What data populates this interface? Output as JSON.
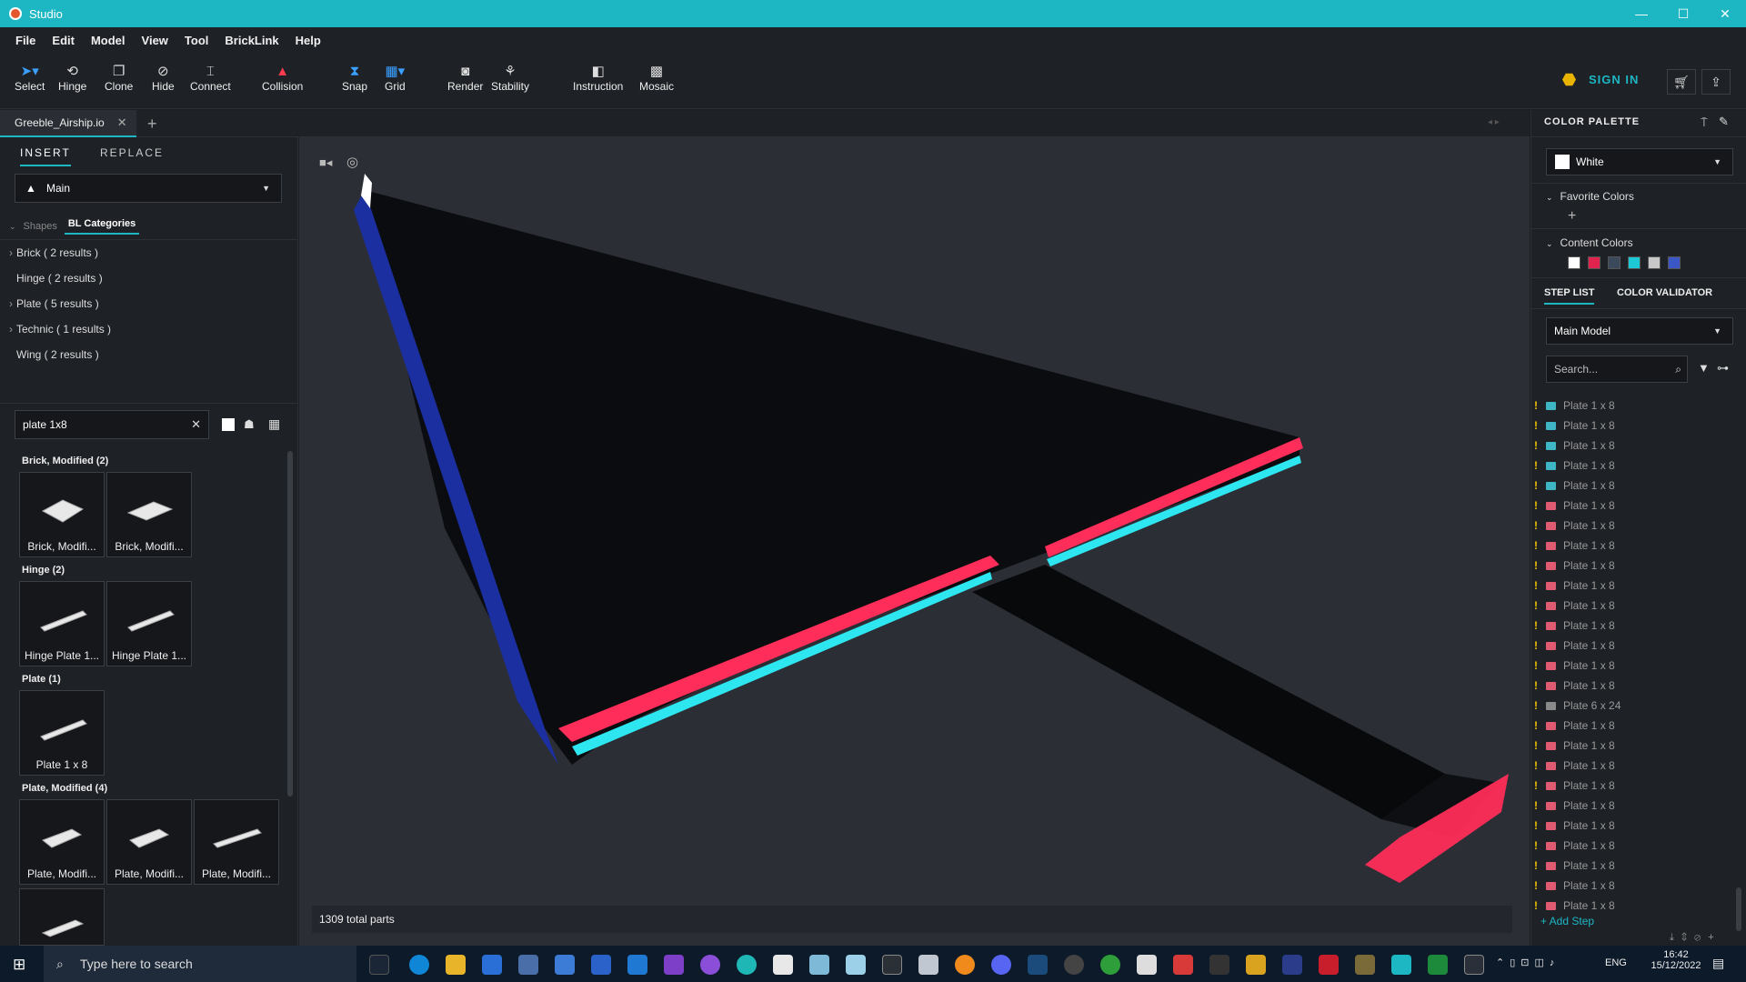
{
  "window": {
    "title": "Studio",
    "minimize": "—",
    "maximize": "☐",
    "close": "✕"
  },
  "menu": [
    "File",
    "Edit",
    "Model",
    "View",
    "Tool",
    "BrickLink",
    "Help"
  ],
  "toolbar": {
    "tools": [
      {
        "label": "Select",
        "icon": "cursor-icon"
      },
      {
        "label": "Hinge",
        "icon": "hinge-icon"
      },
      {
        "label": "Clone",
        "icon": "clone-icon"
      },
      {
        "label": "Hide",
        "icon": "eye-off-icon"
      },
      {
        "label": "Connect",
        "icon": "connect-icon"
      },
      {
        "label": "Collision",
        "icon": "collision-icon"
      },
      {
        "label": "Snap",
        "icon": "snap-icon"
      },
      {
        "label": "Grid",
        "icon": "grid-icon"
      },
      {
        "label": "Render",
        "icon": "camera-icon"
      },
      {
        "label": "Stability",
        "icon": "stability-icon"
      },
      {
        "label": "Instruction",
        "icon": "instruction-icon"
      },
      {
        "label": "Mosaic",
        "icon": "mosaic-icon"
      }
    ],
    "sign_in": "SIGN IN"
  },
  "document_tab": {
    "name": "Greeble_Airship.io"
  },
  "left_panel": {
    "tabs": [
      "INSERT",
      "REPLACE"
    ],
    "palette_select": "Main",
    "subtabs": [
      "Shapes",
      "BL Categories"
    ],
    "categories": [
      "Brick ( 2 results )",
      "Hinge ( 2 results )",
      "Plate ( 5 results )",
      "Technic ( 1 results )",
      "Wing ( 2 results )"
    ],
    "search_value": "plate 1x8",
    "groups": [
      {
        "title": "Brick, Modified (2)",
        "items": [
          "Brick, Modifi...",
          "Brick, Modifi..."
        ]
      },
      {
        "title": "Hinge (2)",
        "items": [
          "Hinge Plate 1...",
          "Hinge Plate 1..."
        ]
      },
      {
        "title": "Plate (1)",
        "items": [
          "Plate 1 x 8"
        ]
      },
      {
        "title": "Plate, Modified (4)",
        "items": [
          "Plate, Modifi...",
          "Plate, Modifi...",
          "Plate, Modifi..."
        ]
      }
    ]
  },
  "viewport": {
    "status": "1309 total parts"
  },
  "right_panel": {
    "color_palette_title": "COLOR PALETTE",
    "selected_color": "White",
    "favorite_colors": "Favorite Colors",
    "content_colors": "Content Colors",
    "content_swatches": [
      "#ffffff",
      "#e0244f",
      "#3a4a5c",
      "#1dc9d4",
      "#c8c8c8",
      "#3b57c6"
    ],
    "step_tabs": [
      "STEP LIST",
      "COLOR VALIDATOR"
    ],
    "model_select": "Main Model",
    "search_placeholder": "Search...",
    "steps": [
      {
        "label": "Plate 1 x 8",
        "color": "#3fb6c5"
      },
      {
        "label": "Plate 1 x 8",
        "color": "#3fb6c5"
      },
      {
        "label": "Plate 1 x 8",
        "color": "#3fb6c5"
      },
      {
        "label": "Plate 1 x 8",
        "color": "#3fb6c5"
      },
      {
        "label": "Plate 1 x 8",
        "color": "#3fb6c5"
      },
      {
        "label": "Plate 1 x 8",
        "color": "#e05a72"
      },
      {
        "label": "Plate 1 x 8",
        "color": "#e05a72"
      },
      {
        "label": "Plate 1 x 8",
        "color": "#e05a72"
      },
      {
        "label": "Plate 1 x 8",
        "color": "#e05a72"
      },
      {
        "label": "Plate 1 x 8",
        "color": "#e05a72"
      },
      {
        "label": "Plate 1 x 8",
        "color": "#e05a72"
      },
      {
        "label": "Plate 1 x 8",
        "color": "#e05a72"
      },
      {
        "label": "Plate 1 x 8",
        "color": "#e05a72"
      },
      {
        "label": "Plate 1 x 8",
        "color": "#e05a72"
      },
      {
        "label": "Plate 1 x 8",
        "color": "#e05a72"
      },
      {
        "label": "Plate 6 x 24",
        "color": "#8a8a8a"
      },
      {
        "label": "Plate 1 x 8",
        "color": "#e05a72"
      },
      {
        "label": "Plate 1 x 8",
        "color": "#e05a72"
      },
      {
        "label": "Plate 1 x 8",
        "color": "#e05a72"
      },
      {
        "label": "Plate 1 x 8",
        "color": "#e05a72"
      },
      {
        "label": "Plate 1 x 8",
        "color": "#e05a72"
      },
      {
        "label": "Plate 1 x 8",
        "color": "#e05a72"
      },
      {
        "label": "Plate 1 x 8",
        "color": "#e05a72"
      },
      {
        "label": "Plate 1 x 8",
        "color": "#e05a72"
      },
      {
        "label": "Plate 1 x 8",
        "color": "#e05a72"
      },
      {
        "label": "Plate 1 x 8",
        "color": "#e05a72"
      }
    ],
    "add_step": "+ Add Step"
  },
  "taskbar": {
    "search_placeholder": "Type here to search",
    "lang": "ENG",
    "time": "16:42",
    "date": "15/12/2022"
  },
  "colors": {
    "accent": "#1db7c4",
    "warning": "#f3c300",
    "model_red": "#ff2d5a",
    "model_cyan": "#2ee6f0",
    "model_blue": "#2a4fd8"
  }
}
